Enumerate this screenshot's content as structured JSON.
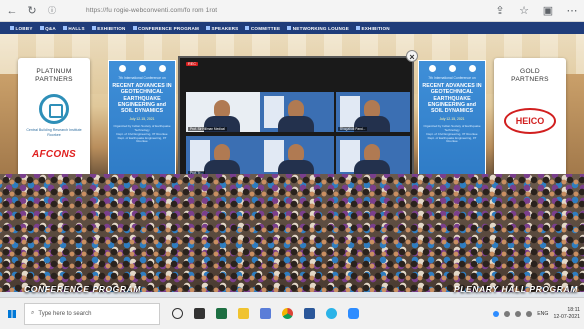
{
  "browser": {
    "url": "https://fu rogie-webconventi.com/fo rom 1rot",
    "icons": [
      "back-arrow-icon",
      "reload-icon",
      "info-icon",
      "share-icon",
      "favorites-icon",
      "tab-actions-icon",
      "menu-icon"
    ]
  },
  "site_nav": {
    "items": [
      "LOBBY",
      "Q&A",
      "HALLS",
      "EXHIBITION",
      "CONFERENCE PROGRAM",
      "SPEAKERS",
      "COMMITTEE",
      "NETWORKING LOUNGE",
      "EXHIBITION"
    ]
  },
  "partners": {
    "platinum": {
      "title_line1": "PLATINUM",
      "title_line2": "PARTNERS",
      "logo1_text": "Central Building Research Institute Roorkee",
      "logo2_text": "AFCONS"
    },
    "gold": {
      "title_line1": "GOLD",
      "title_line2": "PARTNERS",
      "logo_text": "HEICO"
    }
  },
  "conference_banner": {
    "subtitle": "7th International Conference on",
    "title": "RECENT ADVANCES IN GEOTECHNICAL EARTHQUAKE ENGINEERING and SOIL DYNAMICS",
    "date": "July 12-15, 2021",
    "organizer": "Organized by Indian Society of Earthquake Technology",
    "dept1": "Dept. of Civil Engineering, IIT Roorkee",
    "dept2": "Dept. of Earthquake Engineering, IIT Roorkee"
  },
  "zoom": {
    "recording_label": "REC",
    "brand": "zoom",
    "tiles": [
      {
        "label": "Prof. Sir Hillman Medical"
      },
      {
        "label": ""
      },
      {
        "label": "Bhagabati Pand..."
      },
      {
        "label": "Prof. Tr..."
      },
      {
        "label": ""
      },
      {
        "label": ""
      }
    ]
  },
  "bottom": {
    "left_label": "CONFERENCE PROGRAM",
    "right_label": "PLENARY HALL PROGRAM"
  },
  "taskbar": {
    "search_placeholder": "Type here to search",
    "apps": [
      "task-view-icon",
      "file-explorer-icon",
      "excel-icon",
      "folder-icon",
      "store-icon",
      "chrome-icon",
      "word-icon",
      "edge-icon",
      "zoom-icon"
    ],
    "time": "18:11",
    "date": "12-07-2021",
    "lang": "ENG"
  },
  "colors": {
    "nav_bg": "#1f3c7a",
    "banner_blue": "#2d79c4",
    "afcons_red": "#e0201f",
    "heico_red": "#d11f1f"
  }
}
